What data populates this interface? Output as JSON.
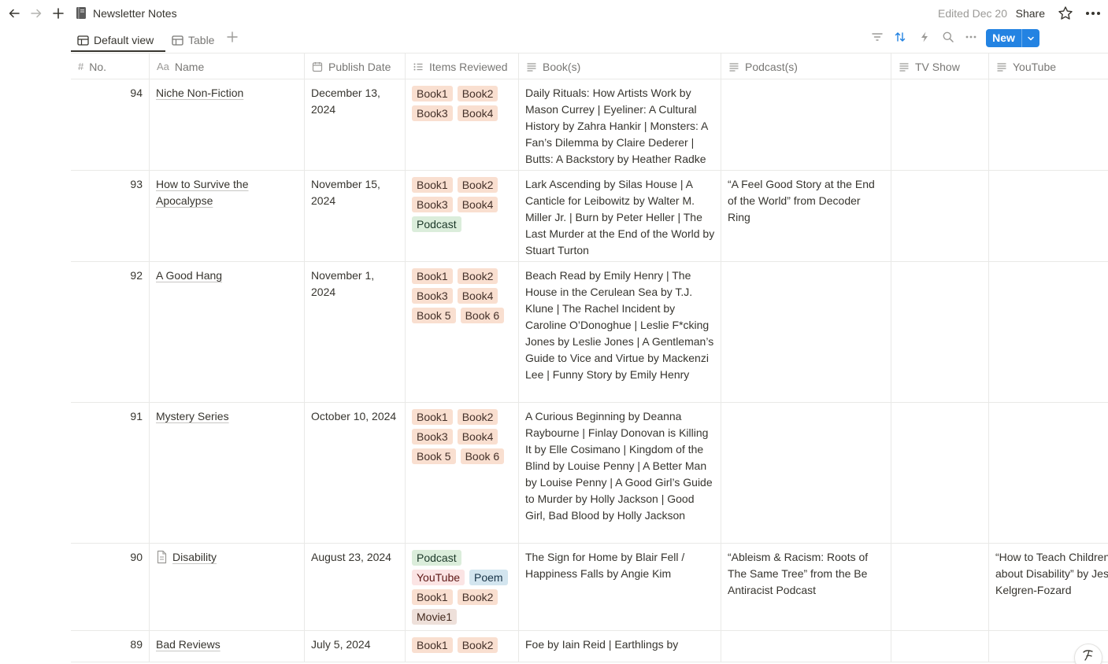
{
  "page": {
    "title": "Newsletter Notes",
    "edited": "Edited Dec 20",
    "share": "Share"
  },
  "views": {
    "default_view": "Default view",
    "table": "Table",
    "new_label": "New"
  },
  "columns": {
    "no": "No.",
    "no_icon": "#",
    "name": "Name",
    "name_icon": "Aa",
    "publish_date": "Publish Date",
    "items_reviewed": "Items Reviewed",
    "books": "Book(s)",
    "podcasts": "Podcast(s)",
    "tv_show": "TV Show",
    "youtube": "YouTube"
  },
  "rows": [
    {
      "no": "94",
      "name": "Niche Non-Fiction",
      "date": "December 13, 2024",
      "tags": [
        "Book1",
        "Book2",
        "Book3",
        "Book4"
      ],
      "books": "Daily Rituals: How Artists Work by Mason Currey | Eyeliner: A Cultural History by Zahra Hankir | Monsters: A Fan’s Dilemma by Claire Dederer | Butts: A Backstory by Heather Radke",
      "podcasts": "",
      "tv": "",
      "youtube": ""
    },
    {
      "no": "93",
      "name": "How to Survive the Apocalypse",
      "date": "November 15, 2024",
      "tags": [
        "Book1",
        "Book2",
        "Book3",
        "Book4",
        "Podcast"
      ],
      "books": "Lark Ascending by Silas House | A Canticle for Leibowitz by Walter M. Miller Jr. | Burn by Peter Heller | The Last Murder at the End of the World by Stuart Turton",
      "podcasts": "“A Feel Good Story at the End of the World” from Decoder Ring",
      "tv": "",
      "youtube": ""
    },
    {
      "no": "92",
      "name": "A Good Hang",
      "date": "November 1, 2024",
      "tags": [
        "Book1",
        "Book2",
        "Book3",
        "Book4",
        "Book 5",
        "Book 6"
      ],
      "books": "Beach Read by Emily Henry | The House in the Cerulean Sea by T.J. Klune | The Rachel Incident by Caroline O’Donoghue | Leslie F*cking Jones by Leslie Jones | A Gentleman’s Guide to Vice and Virtue by Mackenzi Lee | Funny Story by Emily Henry",
      "podcasts": "",
      "tv": "",
      "youtube": ""
    },
    {
      "no": "91",
      "name": "Mystery Series",
      "date": "October 10, 2024",
      "tags": [
        "Book1",
        "Book2",
        "Book3",
        "Book4",
        "Book 5",
        "Book 6"
      ],
      "books": "A Curious Beginning by Deanna Raybourne | Finlay Donovan is Killing It by Elle Cosimano | Kingdom of the Blind by Louise Penny | A Better Man by Louise Penny | A Good Girl’s Guide to Murder by Holly Jackson | Good Girl, Bad Blood by Holly Jackson",
      "podcasts": "",
      "tv": "",
      "youtube": ""
    },
    {
      "no": "90",
      "name": "Disability",
      "date": "August 23, 2024",
      "tags": [
        "Podcast",
        "YouTube",
        "Poem",
        "Book1",
        "Book2",
        "Movie1"
      ],
      "books": "The Sign for Home by Blair Fell / Happiness Falls by Angie Kim",
      "podcasts": "“Ableism & Racism: Roots of The Same Tree” from the Be Antiracist Podcast",
      "tv": "",
      "youtube": "“How to Teach Children about Disability” by Jess Kelgren-Fozard"
    },
    {
      "no": "89",
      "name": "Bad Reviews",
      "date": "July 5, 2024",
      "tags": [
        "Book1",
        "Book2"
      ],
      "books": "Foe by Iain Reid | Earthlings by",
      "podcasts": "",
      "tv": "",
      "youtube": ""
    }
  ],
  "colors": {
    "accent": "#2383e2",
    "book_tag": "#f9dfd0",
    "podcast_tag": "#dbeddb",
    "youtube_tag": "#fbe4e4",
    "poem_tag": "#d3e5ef",
    "movie_tag": "#eee0da"
  }
}
